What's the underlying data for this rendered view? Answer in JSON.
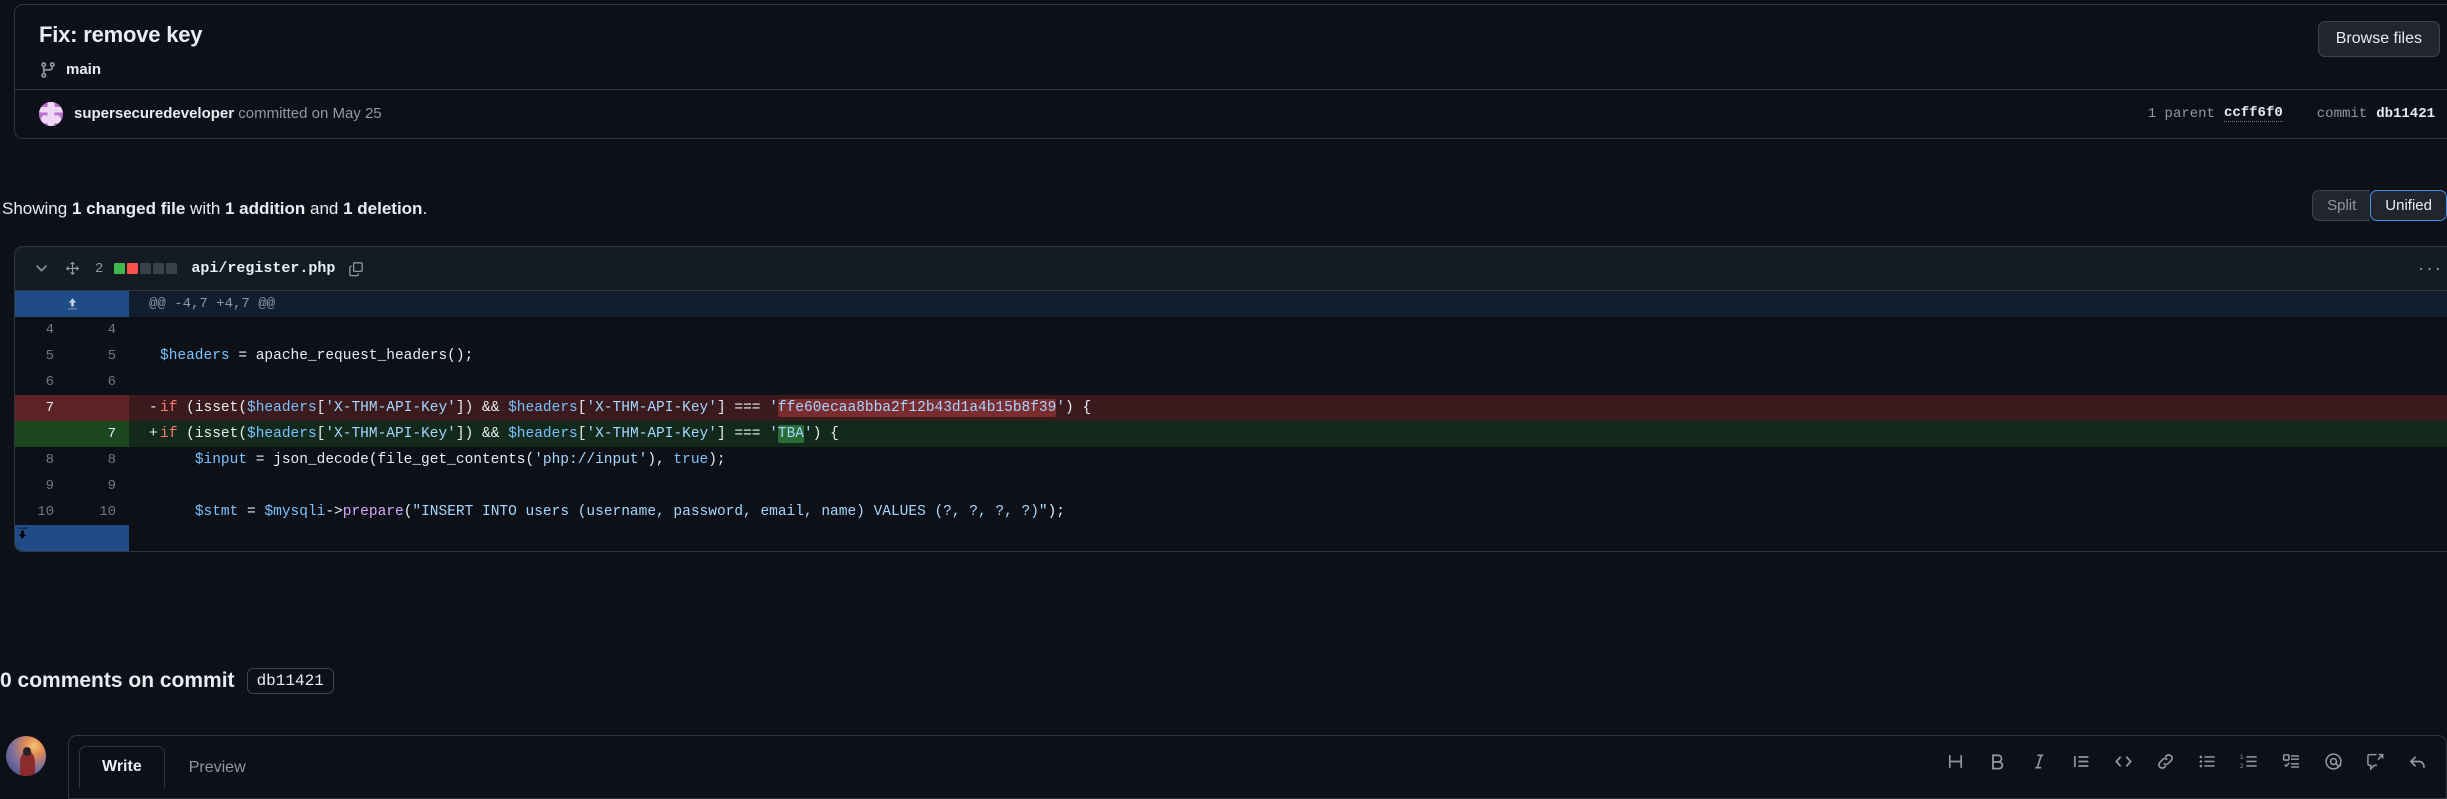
{
  "commit": {
    "title": "Fix: remove key",
    "branch": "main",
    "browse_files_label": "Browse files",
    "author": "supersecuredeveloper",
    "committed_text": "committed on May 25",
    "parent_count_label": "1 parent",
    "parent_sha": "ccff6f0",
    "commit_label": "commit",
    "commit_sha": "db11421"
  },
  "summary": {
    "prefix": "Showing ",
    "changed_files": "1 changed file",
    "with": " with ",
    "additions": "1 addition",
    "and": " and ",
    "deletions": "1 deletion",
    "suffix": ".",
    "split_label": "Split",
    "unified_label": "Unified"
  },
  "file": {
    "change_count": "2",
    "name": "api/register.php",
    "diffstat": [
      "add",
      "del",
      "neu",
      "neu",
      "neu"
    ],
    "menu_glyph": "···"
  },
  "diff": {
    "hunk_header": "@@ -4,7 +4,7 @@",
    "rows": [
      {
        "type": "ctx",
        "old": "4",
        "new": "4",
        "mark": " ",
        "code_plain": ""
      },
      {
        "type": "ctx",
        "old": "5",
        "new": "5",
        "mark": " ",
        "code_plain": "  $headers = apache_request_headers();"
      },
      {
        "type": "ctx",
        "old": "6",
        "new": "6",
        "mark": " ",
        "code_plain": ""
      },
      {
        "type": "del",
        "old": "7",
        "new": "",
        "mark": "-",
        "code_plain": "  if (isset($headers['X-THM-API-Key']) && $headers['X-THM-API-Key'] === 'ffe60ecaa8bba2f12b43d1a4b15b8f39') {"
      },
      {
        "type": "add",
        "old": "",
        "new": "7",
        "mark": "+",
        "code_plain": "  if (isset($headers['X-THM-API-Key']) && $headers['X-THM-API-Key'] === 'TBA') {"
      },
      {
        "type": "ctx",
        "old": "8",
        "new": "8",
        "mark": " ",
        "code_plain": "      $input = json_decode(file_get_contents('php://input'), true);"
      },
      {
        "type": "ctx",
        "old": "9",
        "new": "9",
        "mark": " ",
        "code_plain": ""
      },
      {
        "type": "ctx",
        "old": "10",
        "new": "10",
        "mark": " ",
        "code_plain": "      $stmt = $mysqli->prepare(\"INSERT INTO users (username, password, email, name) VALUES (?, ?, ?, ?)\");"
      }
    ],
    "deleted_secret": "ffe60ecaa8bba2f12b43d1a4b15b8f39",
    "added_secret": "TBA"
  },
  "comments": {
    "heading": "0 comments on commit",
    "sha": "db11421",
    "write_tab": "Write",
    "preview_tab": "Preview",
    "toolbar": [
      "heading-icon",
      "bold-icon",
      "italic-icon",
      "quote-icon",
      "code-icon",
      "link-icon",
      "unordered-list-icon",
      "ordered-list-icon",
      "task-list-icon",
      "mention-icon",
      "saved-reply-icon",
      "reply-icon"
    ]
  },
  "colors": {
    "bg": "#0d1117",
    "border": "#30363d",
    "add_green": "#3fb950",
    "del_red": "#f85149",
    "accent_blue": "#4493f8"
  }
}
